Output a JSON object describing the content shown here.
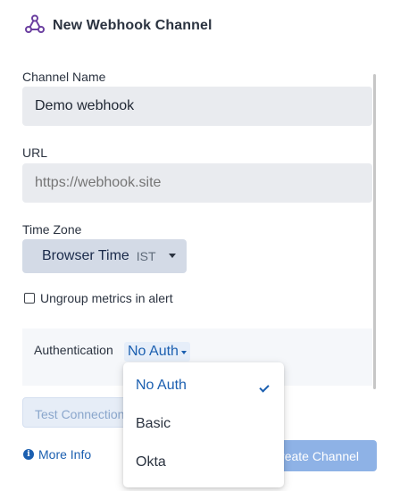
{
  "modal": {
    "title": "New Webhook Channel",
    "icon": "webhook-icon"
  },
  "form": {
    "channel_name": {
      "label": "Channel Name",
      "value": "Demo webhook"
    },
    "url": {
      "label": "URL",
      "placeholder": "https://webhook.site"
    },
    "time_zone": {
      "label": "Time Zone",
      "value": "Browser Time",
      "abbreviation": "IST"
    },
    "ungroup_checkbox": {
      "label": "Ungroup metrics in alert",
      "checked": false
    },
    "authentication": {
      "label": "Authentication",
      "value": "No Auth"
    }
  },
  "auth_dropdown": {
    "options": [
      {
        "label": "No Auth",
        "selected": true
      },
      {
        "label": "Basic",
        "selected": false
      },
      {
        "label": "Okta",
        "selected": false
      }
    ]
  },
  "footer": {
    "test_button_label": "Test Connection",
    "more_info_label": "More Info",
    "create_button_label": "Create Channel"
  },
  "colors": {
    "accent": "#1b5fb0",
    "brand_icon": "#6b3fa0",
    "input_background": "#e9ebef",
    "primary_button": "#8eb2e6"
  }
}
